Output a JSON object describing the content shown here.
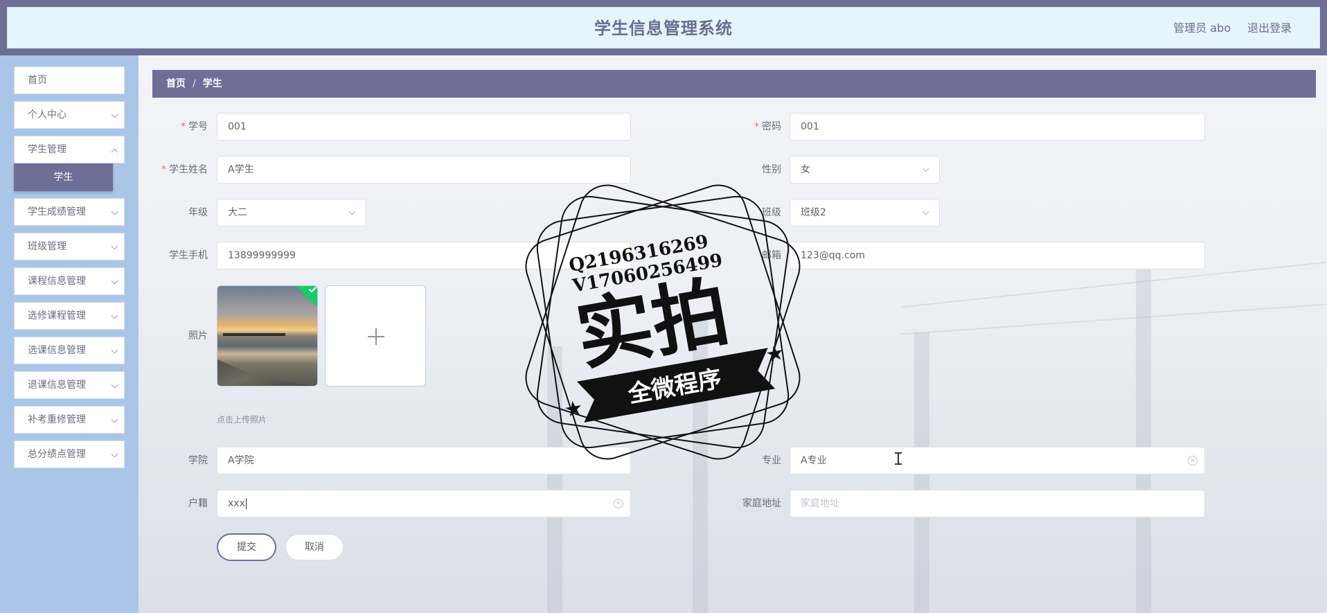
{
  "header": {
    "title": "学生信息管理系统",
    "user": "管理员 abo",
    "logout": "退出登录"
  },
  "sidebar": {
    "items": [
      {
        "label": "首页",
        "has_arrow": false
      },
      {
        "label": "个人中心",
        "has_arrow": true
      },
      {
        "label": "学生管理",
        "has_arrow": true,
        "expanded": true
      },
      {
        "label": "学生成绩管理",
        "has_arrow": true
      },
      {
        "label": "班级管理",
        "has_arrow": true
      },
      {
        "label": "课程信息管理",
        "has_arrow": true
      },
      {
        "label": "选修课程管理",
        "has_arrow": true
      },
      {
        "label": "选课信息管理",
        "has_arrow": true
      },
      {
        "label": "退课信息管理",
        "has_arrow": true
      },
      {
        "label": "补考重修管理",
        "has_arrow": true
      },
      {
        "label": "总分绩点管理",
        "has_arrow": true
      }
    ],
    "submenu": {
      "label": "学生"
    }
  },
  "breadcrumb": {
    "home": "首页",
    "separator": "/",
    "current": "学生"
  },
  "form": {
    "student_id": {
      "label": "学号",
      "value": "001",
      "required": true
    },
    "password": {
      "label": "密码",
      "value": "001",
      "required": true
    },
    "name": {
      "label": "学生姓名",
      "value": "A学生",
      "required": true
    },
    "gender": {
      "label": "性别",
      "value": "女"
    },
    "grade": {
      "label": "年级",
      "value": "大二"
    },
    "class_name": {
      "label": "班级",
      "value": "班级2"
    },
    "phone": {
      "label": "学生手机",
      "value": "13899999999"
    },
    "email": {
      "label": "邮箱",
      "value": "123@qq.com"
    },
    "photo": {
      "label": "照片",
      "hint": "点击上传照片"
    },
    "college": {
      "label": "学院",
      "value": "A学院"
    },
    "major": {
      "label": "专业",
      "value": "A专业"
    },
    "hometown": {
      "label": "户籍",
      "value": "xxx"
    },
    "address": {
      "label": "家庭地址",
      "placeholder": "家庭地址"
    }
  },
  "buttons": {
    "submit": "提交",
    "cancel": "取消"
  },
  "watermark": {
    "line1": "Q2196316269",
    "line2": "V17060256499",
    "main": "实拍",
    "banner": "全微程序"
  },
  "colors": {
    "primary": "#6e6e96",
    "sidebar_bg": "#a9c6e8",
    "header_bg": "#e6f4fb",
    "required": "#f56c6c",
    "success": "#13ce66"
  }
}
